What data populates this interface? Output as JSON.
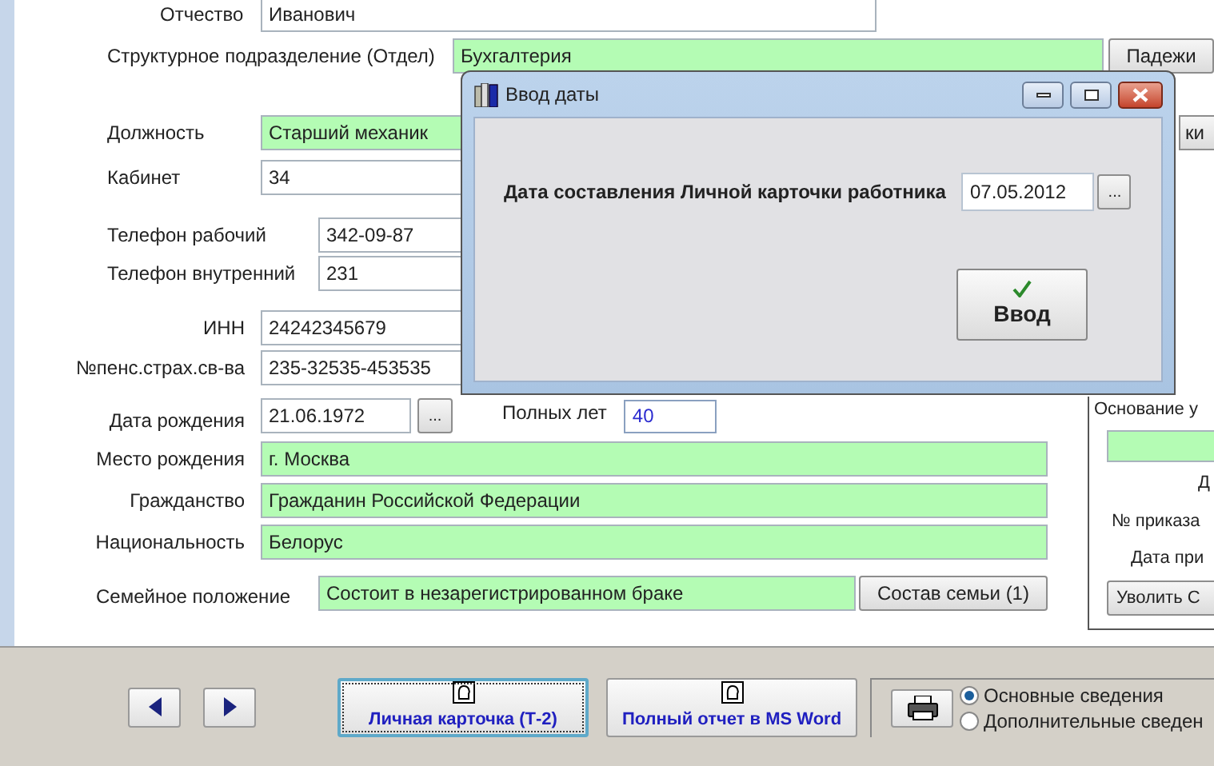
{
  "employee": {
    "patronymic": {
      "label": "Отчество",
      "value": "Иванович"
    },
    "department": {
      "label": "Структурное подразделение (Отдел)",
      "value": "Бухгалтерия",
      "button": "Падежи"
    },
    "position": {
      "label": "Должность",
      "value": "Старший механик",
      "button": "ки"
    },
    "office": {
      "label": "Кабинет",
      "value": "34"
    },
    "phones": [
      {
        "label": "Телефон рабочий",
        "value": "342-09-87"
      },
      {
        "label": "Телефон внутренний",
        "value": "231"
      }
    ],
    "ids": [
      {
        "label": "ИНН",
        "value": "24242345679"
      },
      {
        "label": "№пенс.страх.св-ва",
        "value": "235-32535-453535"
      }
    ],
    "birth_date": {
      "label": "Дата рождения",
      "value": "21.06.1972",
      "button": "..."
    },
    "age": {
      "label": "Полных лет",
      "value": "40"
    },
    "details": [
      {
        "label": "Место рождения",
        "value": "г. Москва"
      },
      {
        "label": "Гражданство",
        "value": "Гражданин Российской Федерации"
      },
      {
        "label": "Национальность",
        "value": "Белорус"
      }
    ],
    "marital": {
      "label": "Семейное положение",
      "value": "Состоит в незарегистрированном браке",
      "button": "Состав семьи (1)"
    }
  },
  "dismissal": {
    "basis_label": "Основание у",
    "labels": [
      "Д",
      "№ приказа",
      "Дата при"
    ],
    "button": "Уволить С"
  },
  "footer": {
    "report_buttons": [
      {
        "label": "Личная карточка (Т-2)",
        "selected": true
      },
      {
        "label": "Полный отчет в MS Word",
        "selected": false
      }
    ],
    "print_options": [
      {
        "label": "Основные сведения",
        "selected": true
      },
      {
        "label": "Дополнительные сведен",
        "selected": false
      }
    ]
  },
  "dialog": {
    "title": "Ввод даты",
    "label": "Дата составления Личной карточки работника",
    "value": "07.05.2012",
    "picker": "...",
    "ok": "Ввод"
  }
}
